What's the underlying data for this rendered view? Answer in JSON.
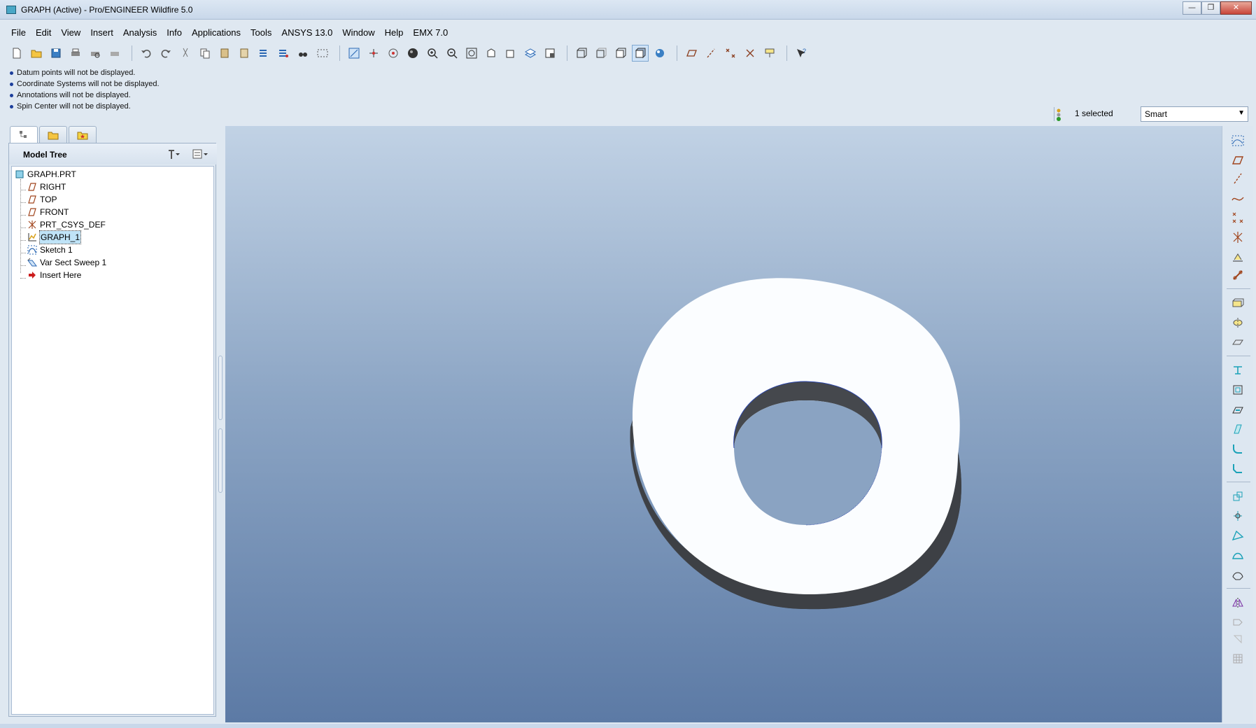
{
  "window": {
    "title": "GRAPH (Active) - Pro/ENGINEER Wildfire 5.0",
    "controls": [
      "minimize",
      "maximize",
      "close"
    ]
  },
  "menu": [
    "File",
    "Edit",
    "View",
    "Insert",
    "Analysis",
    "Info",
    "Applications",
    "Tools",
    "ANSYS 13.0",
    "Window",
    "Help",
    "EMX 7.0"
  ],
  "messages": [
    "Datum points will not be displayed.",
    "Coordinate Systems will not be displayed.",
    "Annotations will not be displayed.",
    "Spin Center will not be displayed."
  ],
  "status": {
    "selected_text": "1 selected",
    "filter_value": "Smart"
  },
  "model_tree": {
    "title": "Model Tree",
    "items": [
      {
        "label": "GRAPH.PRT",
        "icon": "part-icon"
      },
      {
        "label": "RIGHT",
        "icon": "datum-plane-icon"
      },
      {
        "label": "TOP",
        "icon": "datum-plane-icon"
      },
      {
        "label": "FRONT",
        "icon": "datum-plane-icon"
      },
      {
        "label": "PRT_CSYS_DEF",
        "icon": "csys-icon"
      },
      {
        "label": "GRAPH_1",
        "icon": "graph-icon",
        "selected": true
      },
      {
        "label": "Sketch 1",
        "icon": "sketch-icon"
      },
      {
        "label": "Var Sect Sweep 1",
        "icon": "sweep-icon"
      },
      {
        "label": "Insert Here",
        "icon": "insert-arrow-icon"
      }
    ]
  },
  "colors": {
    "accent": "#49a7c6",
    "selection": "#bfe3f7",
    "insert_arrow": "#cc1d1d",
    "part_face": "#fafdff",
    "part_side": "#45484d"
  }
}
